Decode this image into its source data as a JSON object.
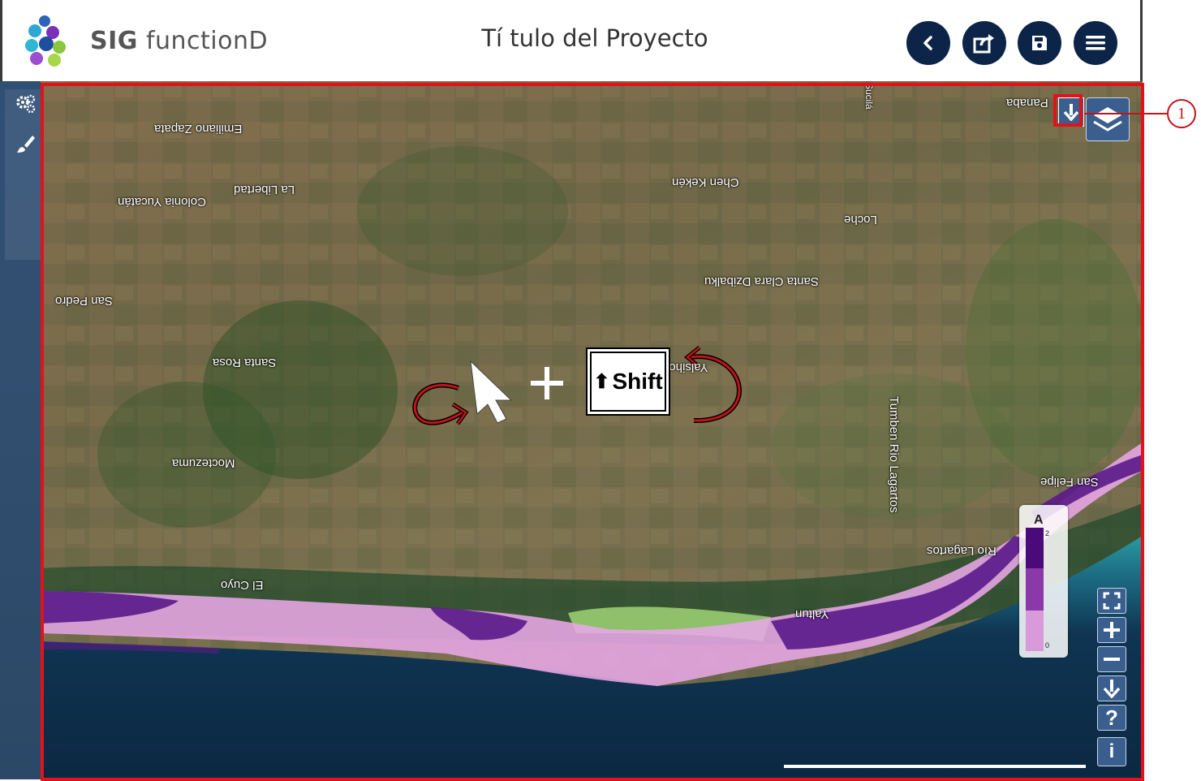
{
  "header": {
    "brand_bold": "SIG",
    "brand_rest": "functionD",
    "project_title": "Tí tulo del Proyecto",
    "buttons": [
      "back-icon",
      "share-icon",
      "save-icon",
      "menu-icon"
    ],
    "accent_color": "#0b2447"
  },
  "sidebar": {
    "icons": [
      "settings-icon",
      "brush-icon"
    ]
  },
  "map": {
    "places": [
      "Emiliano Zapata",
      "Colonia Yucatán",
      "La Libertad",
      "Chen Kekén",
      "Panaba",
      "Loche",
      "Santa Clara Dzibalku",
      "San Pedro",
      "Santa Rosa",
      "Yalsihon",
      "Moctezuma",
      "El Cuyo",
      "Tumben Rio Lagartos",
      "Río Lagartos",
      "San Felipe",
      "Yaltun",
      "Sucilá"
    ],
    "instruction": {
      "plus": "+",
      "key_label": "Shift",
      "key_arrow": "⬆"
    },
    "legend": {
      "title": "A",
      "max": "2",
      "min": "0",
      "colors": [
        "#4a0a7a",
        "#8a3aa8",
        "#d89ad8"
      ]
    },
    "controls": [
      "fullscreen-icon",
      "zoom-in-icon",
      "zoom-out-icon",
      "download-icon",
      "help-icon",
      "info-icon"
    ],
    "overlay_colors": {
      "dark": "#5a1a8a",
      "light": "#e8a7e6"
    }
  },
  "annotation": {
    "callout_number": "1",
    "highlight_color": "#e3111a"
  }
}
